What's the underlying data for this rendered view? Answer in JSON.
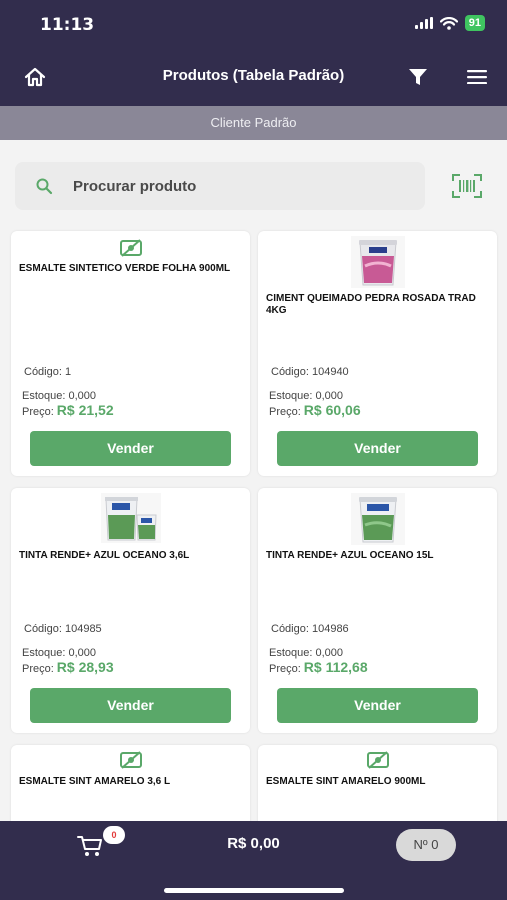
{
  "status": {
    "time": "11:13",
    "battery": "91"
  },
  "nav": {
    "title": "Produtos (Tabela Padrão)"
  },
  "client": {
    "label": "Cliente Padrão"
  },
  "search": {
    "placeholder": "Procurar produto"
  },
  "products": [
    {
      "name": "ESMALTE SINTETICO VERDE FOLHA 900ML",
      "image": "no-image-icon",
      "code": "Código: 1",
      "stock": "Estoque: 0,000",
      "price_label": "Preço:",
      "price": "R$ 21,52",
      "button": "Vender"
    },
    {
      "name": "CIMENT QUEIMADO PEDRA ROSADA TRAD 4KG",
      "image": "paint-bucket-pink",
      "code": "Código: 104940",
      "stock": "Estoque: 0,000",
      "price_label": "Preço:",
      "price": "R$ 60,06",
      "button": "Vender"
    },
    {
      "name": "TINTA RENDE+ AZUL OCEANO 3,6L",
      "image": "paint-cans-blue",
      "code": "Código: 104985",
      "stock": "Estoque: 0,000",
      "price_label": "Preço:",
      "price": "R$ 28,93",
      "button": "Vender"
    },
    {
      "name": "TINTA RENDE+ AZUL OCEANO 15L",
      "image": "paint-bucket-blue",
      "code": "Código: 104986",
      "stock": "Estoque: 0,000",
      "price_label": "Preço:",
      "price": "R$ 112,68",
      "button": "Vender"
    },
    {
      "name": "ESMALTE SINT AMARELO 3,6 L",
      "image": "no-image-icon"
    },
    {
      "name": "ESMALTE SINT AMARELO 900ML",
      "image": "no-image-icon"
    }
  ],
  "footer": {
    "cart_count": "0",
    "total": "R$ 0,00",
    "order": "Nº 0"
  },
  "colors": {
    "header": "#322d4d",
    "client_bar": "#8a8797",
    "accent": "#5aa869"
  }
}
